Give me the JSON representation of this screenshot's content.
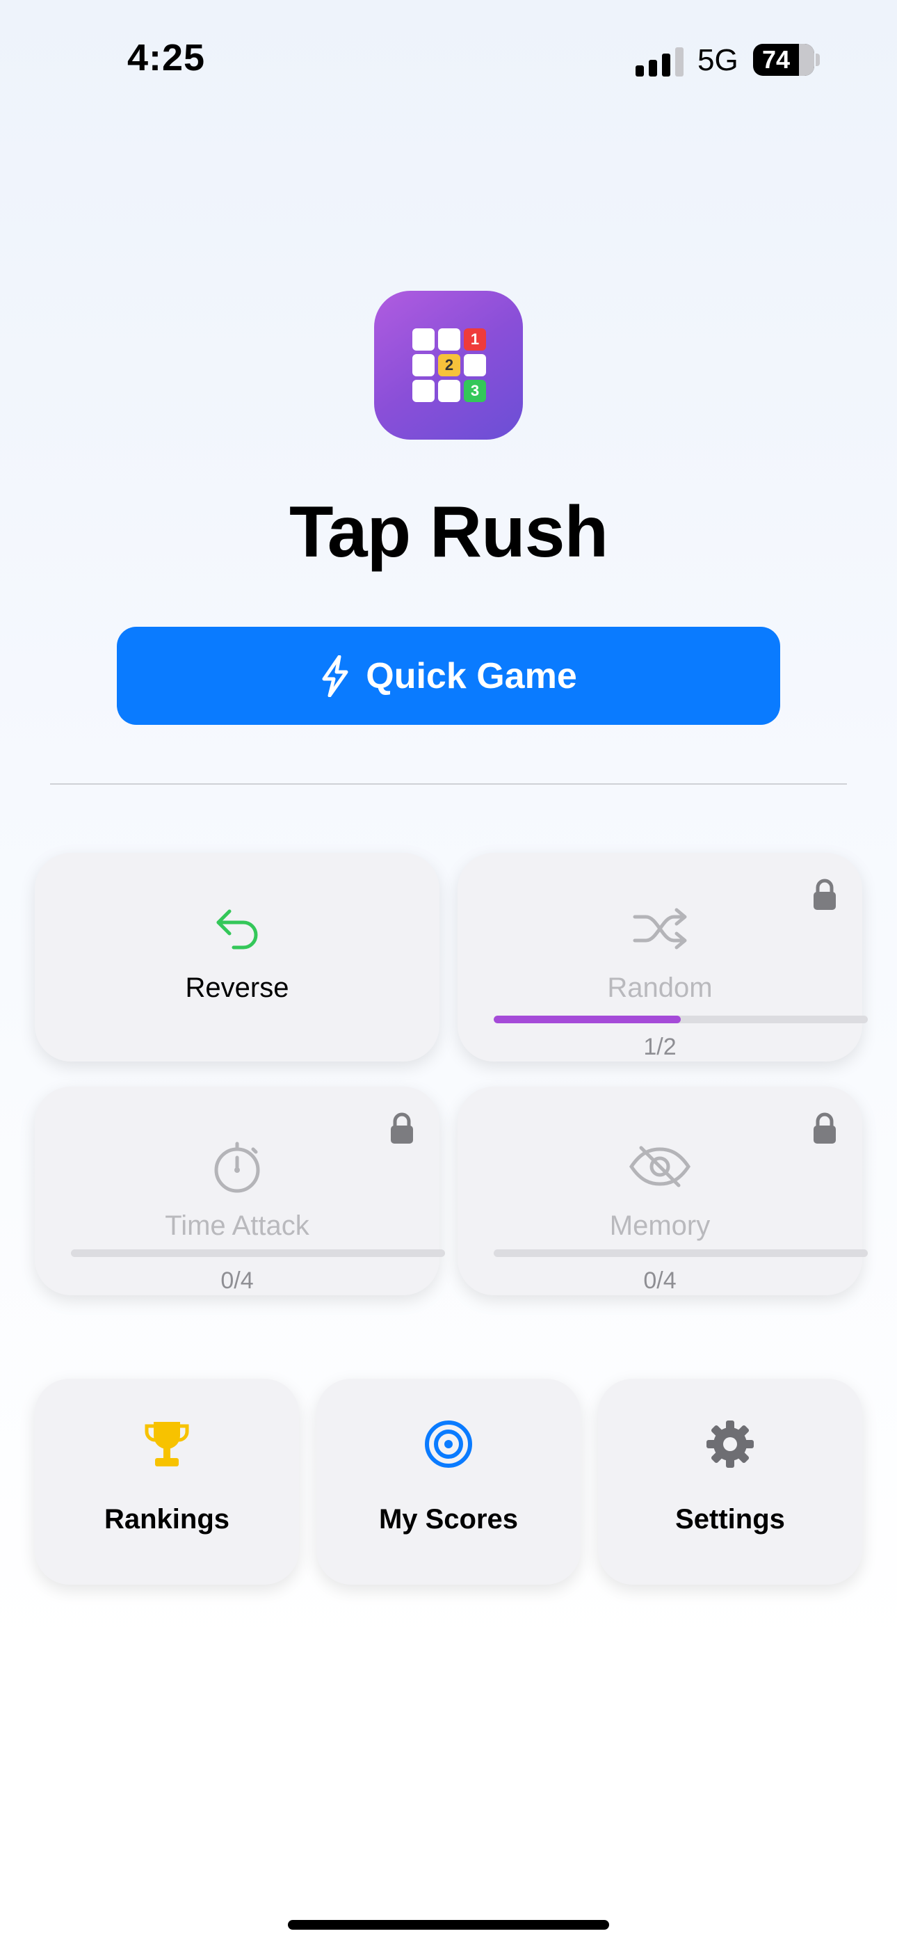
{
  "status_bar": {
    "time": "4:25",
    "network": "5G",
    "battery": "74"
  },
  "app": {
    "title": "Tap Rush",
    "icon_grid": [
      "",
      "",
      "1",
      "",
      "2",
      "",
      "",
      "",
      "3"
    ]
  },
  "quick_game": {
    "label": "Quick Game",
    "icon": "bolt-icon"
  },
  "modes": [
    {
      "label": "Reverse",
      "icon": "reverse-arrow-icon",
      "locked": false,
      "color": "#34c759"
    },
    {
      "label": "Random",
      "icon": "shuffle-icon",
      "locked": true,
      "progress_text": "1/2",
      "progress": 0.5,
      "progress_color": "#a54bd8"
    },
    {
      "label": "Time Attack",
      "icon": "stopwatch-icon",
      "locked": true,
      "progress_text": "0/4",
      "progress": 0
    },
    {
      "label": "Memory",
      "icon": "eye-slash-icon",
      "locked": true,
      "progress_text": "0/4",
      "progress": 0
    }
  ],
  "tiles": [
    {
      "label": "Rankings",
      "icon": "trophy-icon",
      "color": "#f7c200"
    },
    {
      "label": "My Scores",
      "icon": "target-icon",
      "color": "#0a7bff"
    },
    {
      "label": "Settings",
      "icon": "gear-icon",
      "color": "#6e6e73"
    }
  ],
  "colors": {
    "accent": "#0a7bff",
    "icon_gradient": [
      "#b05ce0",
      "#6b4fd6"
    ]
  }
}
